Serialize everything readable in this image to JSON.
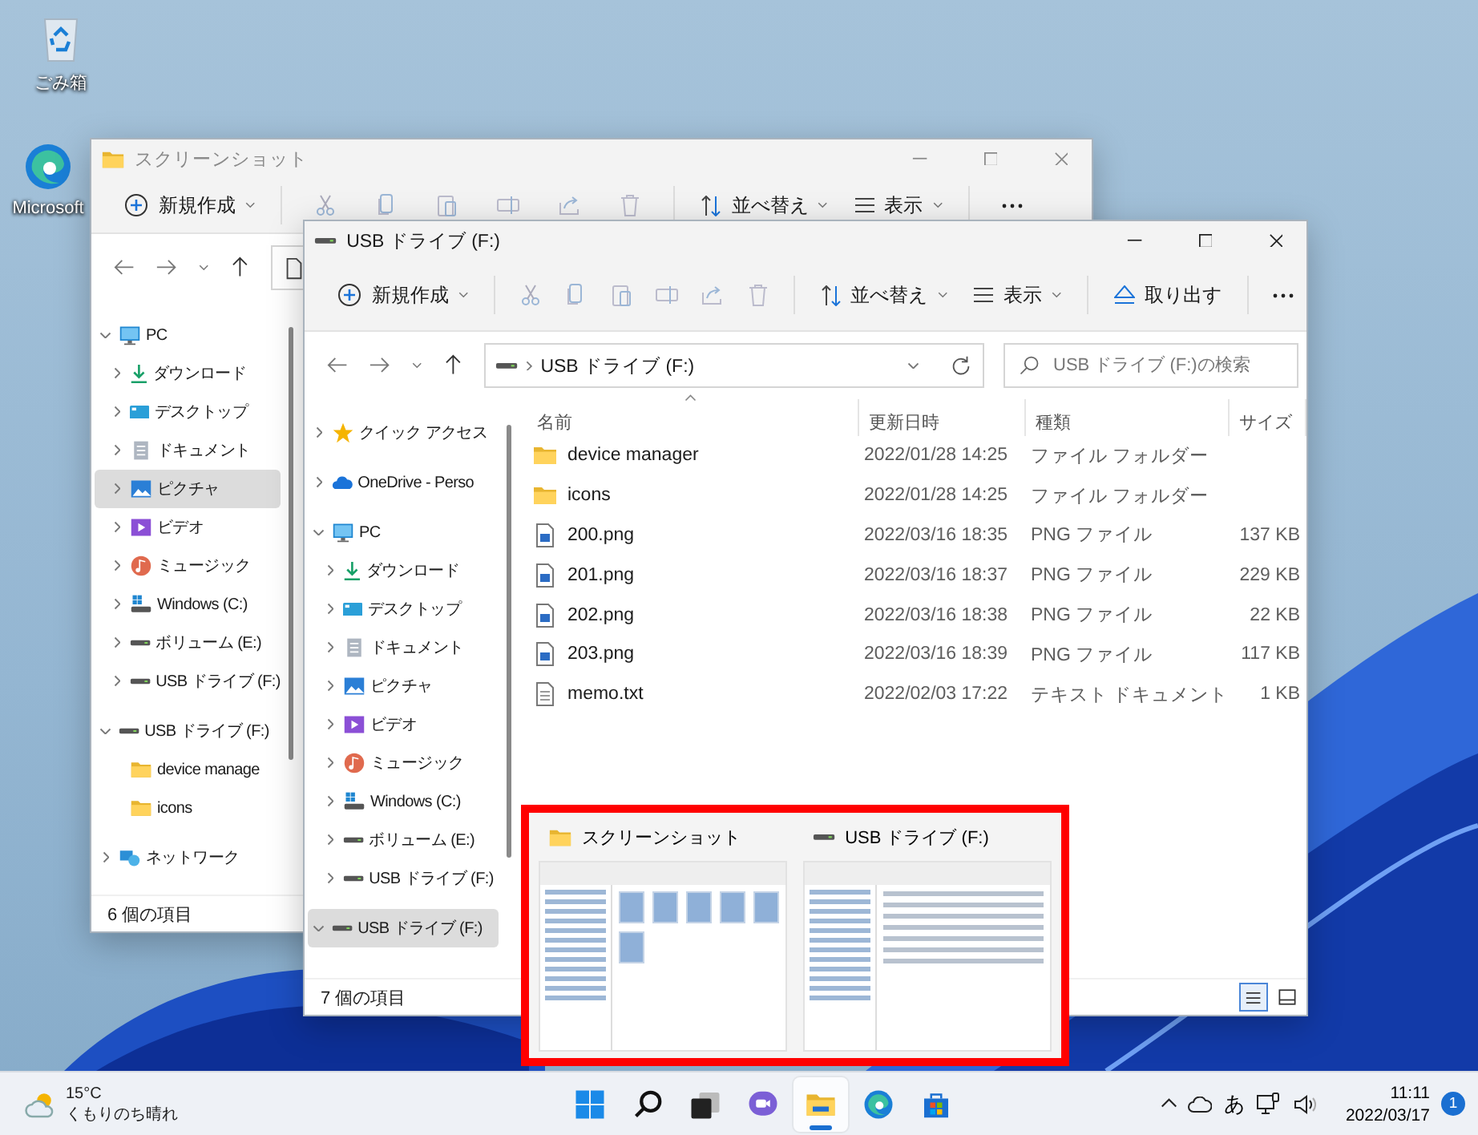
{
  "desktop_icons": [
    {
      "kind": "recycle-bin",
      "label": "ごみ箱"
    },
    {
      "kind": "edge",
      "label": "Microsoft"
    }
  ],
  "windows": [
    {
      "title": "スクリーンショット",
      "kind": "folder",
      "active": false,
      "toolbar": {
        "new": "新規作成",
        "sort": "並べ替え",
        "view": "表示"
      },
      "address": {
        "kind": "page"
      },
      "nav_pane": [
        {
          "label": "PC",
          "kind": "pc",
          "expanded": true,
          "selected": false,
          "children": [
            {
              "label": "ダウンロード",
              "kind": "download",
              "expanded": false,
              "selected": false
            },
            {
              "label": "デスクトップ",
              "kind": "desktop",
              "expanded": false,
              "selected": false
            },
            {
              "label": "ドキュメント",
              "kind": "documents",
              "expanded": false,
              "selected": false
            },
            {
              "label": "ピクチャ",
              "kind": "pictures",
              "expanded": false,
              "selected": true
            },
            {
              "label": "ビデオ",
              "kind": "videos",
              "expanded": false,
              "selected": false
            },
            {
              "label": "ミュージック",
              "kind": "music",
              "expanded": false,
              "selected": false
            },
            {
              "label": "Windows (C:)",
              "kind": "windows-drive",
              "expanded": false,
              "selected": false
            },
            {
              "label": "ボリューム (E:)",
              "kind": "drive",
              "expanded": false,
              "selected": false
            },
            {
              "label": "USB ドライブ (F:)",
              "kind": "drive",
              "expanded": false,
              "selected": false
            }
          ]
        },
        {
          "label": "USB ドライブ (F:)",
          "kind": "drive",
          "expanded": true,
          "selected": false,
          "children": [
            {
              "label": "device manage",
              "kind": "folder",
              "selected": false
            },
            {
              "label": "icons",
              "kind": "folder",
              "selected": false
            }
          ]
        },
        {
          "label": "ネットワーク",
          "kind": "network",
          "expanded": false,
          "selected": false
        }
      ],
      "status": "6 個の項目"
    },
    {
      "title": "USB ドライブ (F:)",
      "kind": "drive",
      "active": true,
      "toolbar": {
        "new": "新規作成",
        "sort": "並べ替え",
        "view": "表示",
        "eject": "取り出す"
      },
      "address": {
        "kind": "drive",
        "path": "USB ドライブ (F:)"
      },
      "search": {
        "placeholder": "USB ドライブ (F:)の検索"
      },
      "nav_pane": [
        {
          "label": "クイック アクセス",
          "kind": "star",
          "expanded": false,
          "selected": false
        },
        {
          "label": "OneDrive - Perso",
          "kind": "cloud",
          "expanded": false,
          "selected": false
        },
        {
          "label": "PC",
          "kind": "pc",
          "expanded": true,
          "selected": false,
          "children": [
            {
              "label": "ダウンロード",
              "kind": "download",
              "expanded": false,
              "selected": false
            },
            {
              "label": "デスクトップ",
              "kind": "desktop",
              "expanded": false,
              "selected": false
            },
            {
              "label": "ドキュメント",
              "kind": "documents",
              "expanded": false,
              "selected": false
            },
            {
              "label": "ピクチャ",
              "kind": "pictures",
              "expanded": false,
              "selected": false
            },
            {
              "label": "ビデオ",
              "kind": "videos",
              "expanded": false,
              "selected": false
            },
            {
              "label": "ミュージック",
              "kind": "music",
              "expanded": false,
              "selected": false
            },
            {
              "label": "Windows (C:)",
              "kind": "windows-drive",
              "expanded": false,
              "selected": false
            },
            {
              "label": "ボリューム (E:)",
              "kind": "drive",
              "expanded": false,
              "selected": false
            },
            {
              "label": "USB ドライブ (F:)",
              "kind": "drive",
              "expanded": false,
              "selected": false
            }
          ]
        },
        {
          "label": "USB ドライブ (F:)",
          "kind": "drive",
          "expanded": true,
          "selected": true
        }
      ],
      "file_list": {
        "columns": [
          "名前",
          "更新日時",
          "種類",
          "サイズ"
        ],
        "rows": [
          {
            "kind": "folder",
            "name": "device manager",
            "modified": "2022/01/28 14:25",
            "type": "ファイル フォルダー"
          },
          {
            "kind": "folder",
            "name": "icons",
            "modified": "2022/01/28 14:25",
            "type": "ファイル フォルダー"
          },
          {
            "kind": "image",
            "name": "200.png",
            "modified": "2022/03/16 18:35",
            "type": "PNG ファイル",
            "size": "137 KB"
          },
          {
            "kind": "image",
            "name": "201.png",
            "modified": "2022/03/16 18:37",
            "type": "PNG ファイル",
            "size": "229 KB"
          },
          {
            "kind": "image",
            "name": "202.png",
            "modified": "2022/03/16 18:38",
            "type": "PNG ファイル",
            "size": "22 KB"
          },
          {
            "kind": "image",
            "name": "203.png",
            "modified": "2022/03/16 18:39",
            "type": "PNG ファイル",
            "size": "117 KB"
          },
          {
            "kind": "text",
            "name": "memo.txt",
            "modified": "2022/02/03 17:22",
            "type": "テキスト ドキュメント",
            "size": "1 KB"
          }
        ]
      },
      "status": "7 個の項目"
    }
  ],
  "thumbnail_preview": [
    {
      "title": "スクリーンショット",
      "kind": "folder"
    },
    {
      "title": "USB ドライブ (F:)",
      "kind": "drive"
    }
  ],
  "taskbar": {
    "weather": {
      "temp": "15°C",
      "condition": "くもりのち晴れ"
    },
    "apps": [
      {
        "kind": "start",
        "active": false
      },
      {
        "kind": "search",
        "active": false
      },
      {
        "kind": "task-view",
        "active": false
      },
      {
        "kind": "chat",
        "active": false
      },
      {
        "kind": "explorer",
        "active": true
      },
      {
        "kind": "edge",
        "active": false
      },
      {
        "kind": "store",
        "active": false
      }
    ],
    "ime": "あ",
    "time": "11:11",
    "date": "2022/03/17",
    "notifications": "1"
  }
}
